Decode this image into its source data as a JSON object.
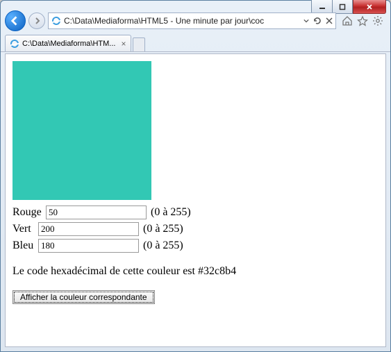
{
  "window": {
    "address": "C:\\Data\\Mediaforma\\HTML5 - Une minute par jour\\coc",
    "tab_title": "C:\\Data\\Mediaforma\\HTM..."
  },
  "swatch_color": "#32c8b4",
  "fields": {
    "rouge": {
      "label": "Rouge",
      "value": "50",
      "hint": "(0 à 255)"
    },
    "vert": {
      "label": "Vert",
      "value": "200",
      "hint": "(0 à 255)"
    },
    "bleu": {
      "label": "Bleu",
      "value": "180",
      "hint": "(0 à 255)"
    }
  },
  "result_prefix": "Le code hexadécimal de cette couleur est ",
  "result_code": "#32c8b4",
  "button_label": "Afficher la couleur correspondante"
}
